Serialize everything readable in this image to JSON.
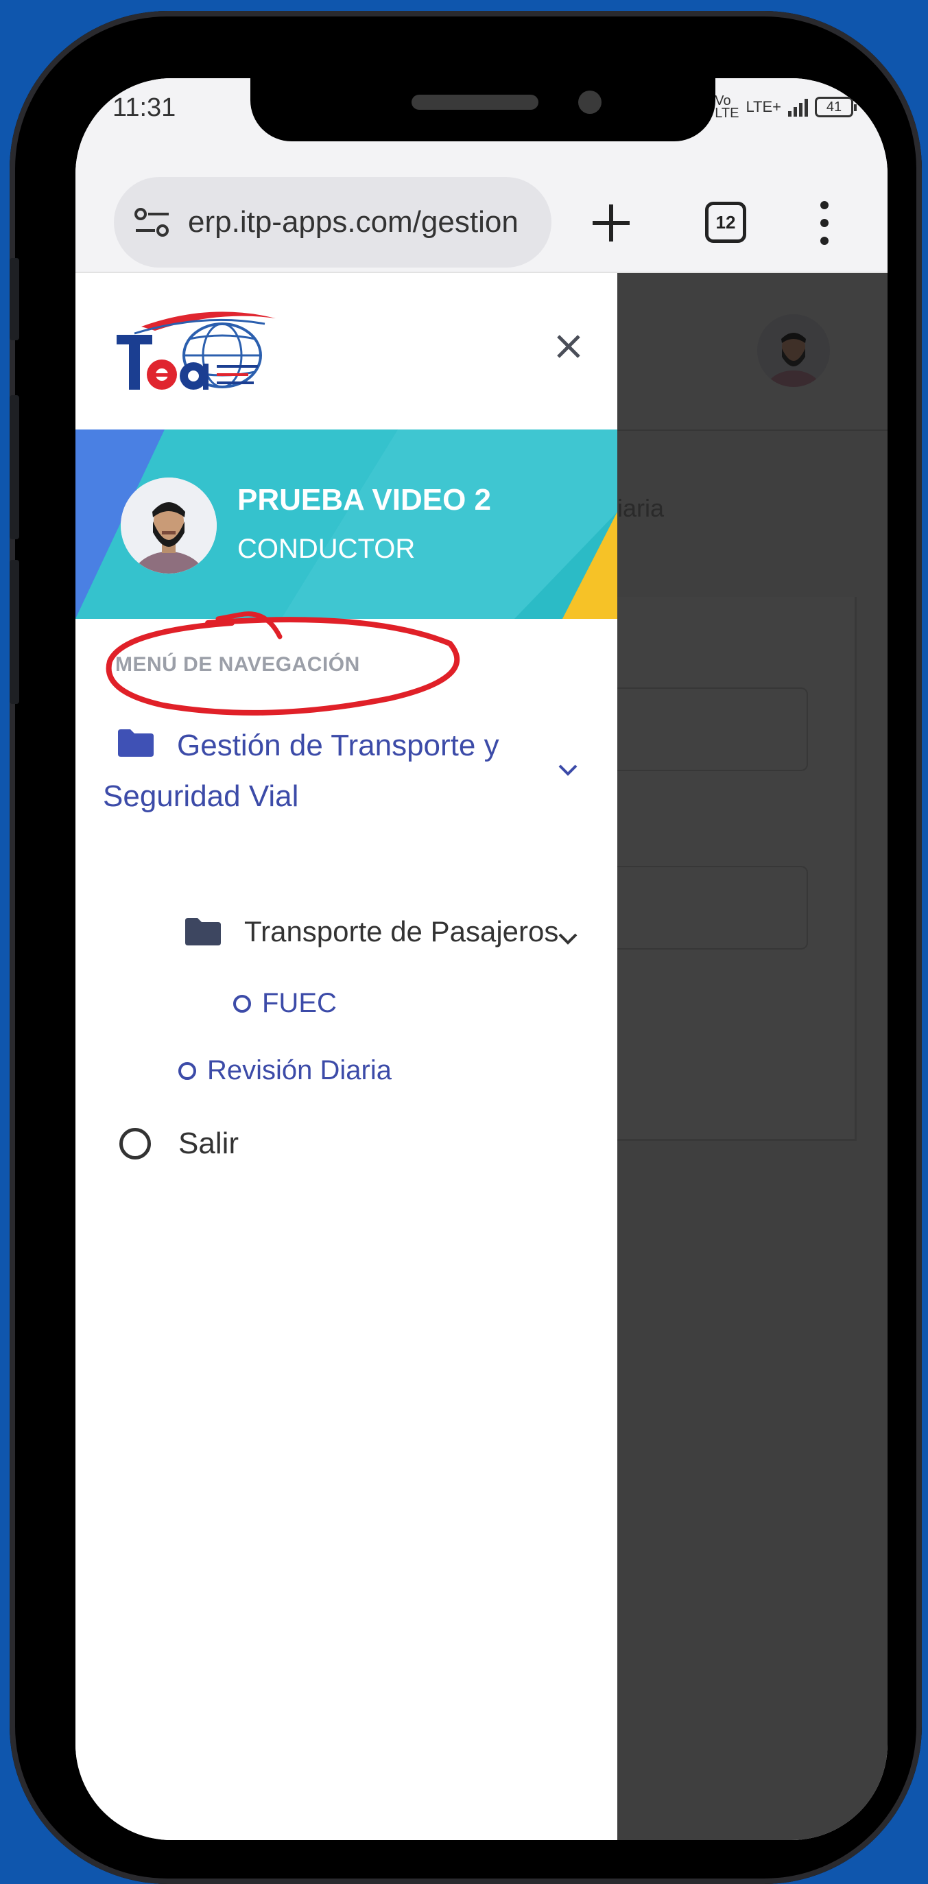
{
  "status_bar": {
    "time": "11:31",
    "network_top": "Vo",
    "network_bottom": "LTE",
    "network_type": "LTE+",
    "battery": "41"
  },
  "browser": {
    "url": "erp.itp-apps.com/gestion",
    "tab_count": "12"
  },
  "drawer": {
    "profile_name": "PRUEBA VIDEO 2",
    "profile_role": "CONDUCTOR",
    "nav_header": "MENÚ DE NAVEGACIÓN",
    "nav": {
      "group_label": "Gestión de Transporte y Seguridad Vial",
      "subgroup_label": "Transporte de Pasajeros",
      "fuec_label": "FUEC",
      "revision_label": "Revisión Diaria",
      "exit_label": "Salir"
    }
  },
  "background_page": {
    "partial_title": "iaria"
  },
  "colors": {
    "frame_background": "#0f56ad",
    "nav_link": "#3c4ba8",
    "profile_banner": "#2bbbc6",
    "annotation": "#e02028"
  }
}
